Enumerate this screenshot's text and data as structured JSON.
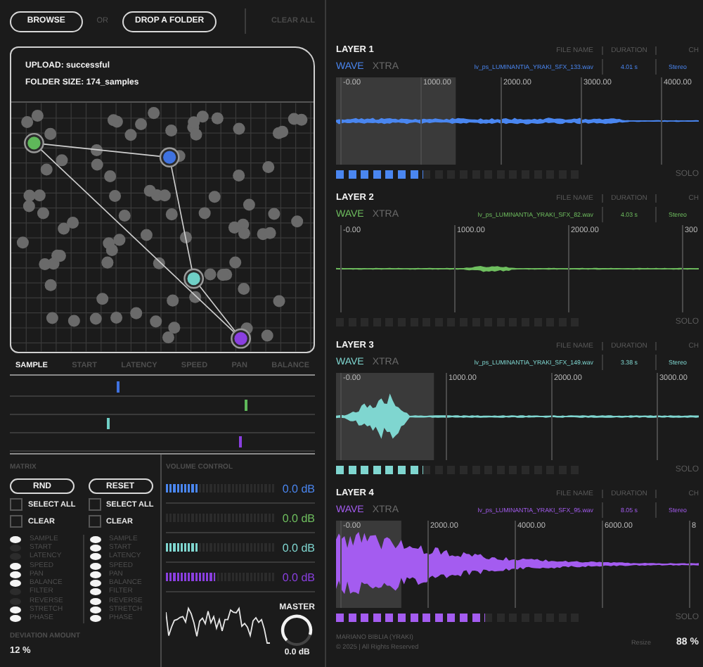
{
  "toolbar": {
    "browse": "BROWSE",
    "or": "OR",
    "drop": "DROP A FOLDER",
    "clear_all": {
      "label": "CLEAR ALL",
      "disabled": true
    }
  },
  "upload_panel": {
    "status": "UPLOAD: successful",
    "folder_size": "FOLDER SIZE: 174_samples"
  },
  "param_tabs": [
    {
      "label": "SAMPLE",
      "selected": true
    },
    {
      "label": "START",
      "selected": false
    },
    {
      "label": "LATENCY",
      "selected": false
    },
    {
      "label": "SPEED",
      "selected": false
    },
    {
      "label": "PAN",
      "selected": false
    },
    {
      "label": "BALANCE",
      "selected": false
    }
  ],
  "lanes": [
    {
      "level": 0.35,
      "color": "#3f72e0"
    },
    {
      "level": 0.77,
      "color": "#5fb85a"
    },
    {
      "level": 0.32,
      "color": "#6fcfc6"
    },
    {
      "level": 0.75,
      "color": "#8a3fe0"
    }
  ],
  "matrix": {
    "title": "MATRIX",
    "columns": [
      {
        "button": "RND",
        "select_all": {
          "label": "SELECT ALL",
          "checked": false
        },
        "clear": {
          "label": "CLEAR",
          "checked": false
        },
        "toggles": [
          {
            "label": "SAMPLE",
            "on": true
          },
          {
            "label": "START",
            "on": false
          },
          {
            "label": "LATENCY",
            "on": false
          },
          {
            "label": "SPEED",
            "on": true
          },
          {
            "label": "PAN",
            "on": true
          },
          {
            "label": "BALANCE",
            "on": true
          },
          {
            "label": "FILTER",
            "on": false
          },
          {
            "label": "REVERSE",
            "on": false
          },
          {
            "label": "STRETCH",
            "on": true
          },
          {
            "label": "PHASE",
            "on": true
          }
        ]
      },
      {
        "button": "RESET",
        "select_all": {
          "label": "SELECT ALL",
          "checked": false
        },
        "clear": {
          "label": "CLEAR",
          "checked": false
        },
        "toggles": [
          {
            "label": "SAMPLE",
            "on": true
          },
          {
            "label": "START",
            "on": true
          },
          {
            "label": "LATENCY",
            "on": true
          },
          {
            "label": "SPEED",
            "on": true
          },
          {
            "label": "PAN",
            "on": true
          },
          {
            "label": "BALANCE",
            "on": true
          },
          {
            "label": "FILTER",
            "on": true
          },
          {
            "label": "REVERSE",
            "on": true
          },
          {
            "label": "STRETCH",
            "on": true
          },
          {
            "label": "PHASE",
            "on": true
          }
        ]
      }
    ],
    "deviation_label": "DEVIATION AMOUNT",
    "deviation_value": "12 %"
  },
  "volume": {
    "title": "VOLUME CONTROL",
    "rows": [
      {
        "level": 0.3,
        "reading": "0.0 dB",
        "color": "#4a86f0"
      },
      {
        "reading": "0.0 dB",
        "color": "#6fbf5f"
      },
      {
        "level": 0.3,
        "reading": "0.0 dB",
        "color": "#7fd6d0"
      },
      {
        "level": 0.45,
        "reading": "0.0 dB",
        "color": "#8a3fe0"
      }
    ],
    "master": {
      "label": "MASTER",
      "reading": "0.0 dB"
    }
  },
  "layers": [
    {
      "title": "LAYER 1",
      "color": "#4a86f0",
      "tabs": [
        {
          "label": "WAVE",
          "selected": true
        },
        {
          "label": "XTRA",
          "selected": false
        }
      ],
      "file_name_header": "FILE NAME",
      "duration_header": "DURATION",
      "ch_header": "CH",
      "file_name": "lv_ps_LUMINANTIA_YRAKI_SFX_133.wav",
      "duration": "4.01 s",
      "ch": "Stereo",
      "ruler": [
        "-0.00",
        "1000.00",
        "2000.00",
        "3000.00",
        "4000.00"
      ],
      "level": 0.35,
      "solo": "SOLO"
    },
    {
      "title": "LAYER 2",
      "color": "#6fbf5f",
      "tabs": [
        {
          "label": "WAVE",
          "selected": true
        },
        {
          "label": "XTRA",
          "selected": false
        }
      ],
      "file_name_header": "FILE NAME",
      "duration_header": "DURATION",
      "ch_header": "CH",
      "file_name": "lv_ps_LUMINANTIA_YRAKI_SFX_82.wav",
      "duration": "4.03 s",
      "ch": "Stereo",
      "ruler": [
        "-0.00",
        "1000.00",
        "2000.00",
        "300"
      ],
      "solo": "SOLO"
    },
    {
      "title": "LAYER 3",
      "color": "#7fd6d0",
      "tabs": [
        {
          "label": "WAVE",
          "selected": true
        },
        {
          "label": "XTRA",
          "selected": false
        }
      ],
      "file_name_header": "FILE NAME",
      "duration_header": "DURATION",
      "ch_header": "CH",
      "file_name": "lv_ps_LUMINANTIA_YRAKI_SFX_149.wav",
      "duration": "3.38 s",
      "ch": "Stereo",
      "ruler": [
        "-0.00",
        "1000.00",
        "2000.00",
        "3000.00"
      ],
      "level": 0.35,
      "solo": "SOLO"
    },
    {
      "title": "LAYER 4",
      "color": "#a45cf0",
      "tabs": [
        {
          "label": "WAVE",
          "selected": true
        },
        {
          "label": "XTRA",
          "selected": false
        }
      ],
      "file_name_header": "FILE NAME",
      "duration_header": "DURATION",
      "ch_header": "CH",
      "file_name": "lv_ps_LUMINANTIA_YRAKI_SFX_95.wav",
      "duration": "8.05 s",
      "ch": "Stereo",
      "ruler": [
        "-0.00",
        "2000.00",
        "4000.00",
        "6000.00",
        "8"
      ],
      "level": 0.6,
      "solo": "SOLO"
    }
  ],
  "footer": {
    "author": "MARIANO BIBLIA (YRAKI)",
    "copyright": "© 2025 | All Rights Reserved",
    "resize_label": "Resize",
    "resize_value": "88 %"
  }
}
